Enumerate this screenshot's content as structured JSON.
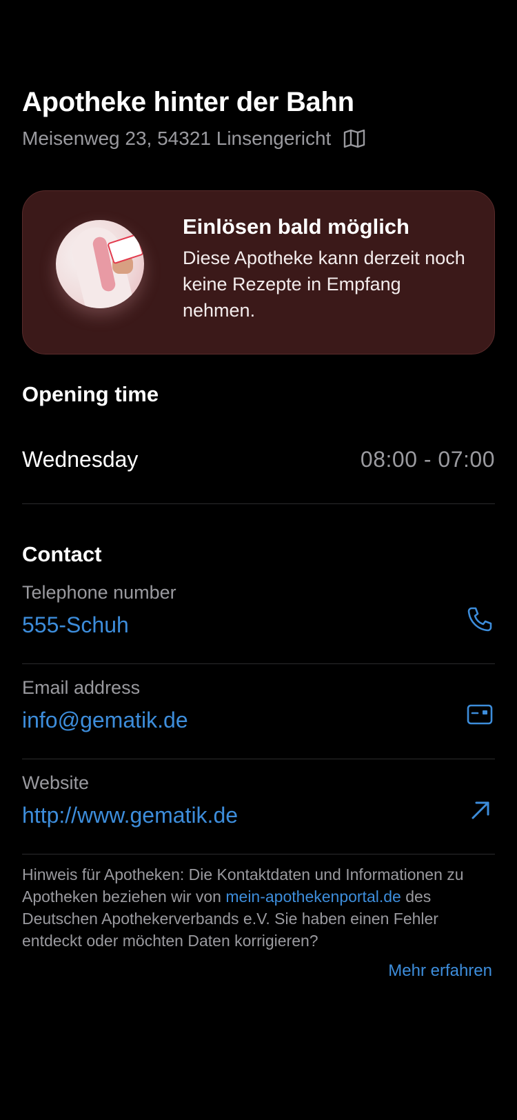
{
  "pharmacy": {
    "name": "Apotheke hinter der Bahn",
    "address": "Meisenweg 23, 54321 Linsengericht",
    "address_icon": "map-icon"
  },
  "banner": {
    "title": "Einlösen bald möglich",
    "text": "Diese Apotheke kann derzeit noch keine Rezepte in Empfang nehmen.",
    "background_color": "#3b1919"
  },
  "opening": {
    "heading": "Opening time",
    "rows": [
      {
        "day": "Wednesday",
        "hours": "08:00 - 07:00"
      }
    ]
  },
  "contact": {
    "heading": "Contact",
    "phone": {
      "label": "Telephone number",
      "value": "555-Schuh",
      "icon": "phone-icon"
    },
    "email": {
      "label": "Email address",
      "value": "info@gematik.de",
      "icon": "mail-icon"
    },
    "website": {
      "label": "Website",
      "value": "http://www.gematik.de",
      "icon": "arrow-up-right-icon"
    }
  },
  "hint": {
    "text_before": "Hinweis für Apotheken: Die Kontaktdaten und Informationen zu Apotheken beziehen wir von ",
    "link_text": "mein-apothekenportal.de",
    "text_after": " des Deutschen Apothekerverbands e.V. Sie haben einen Fehler entdeckt oder möchten Daten korrigieren?",
    "more_label": "Mehr erfahren"
  },
  "colors": {
    "accent": "#3d8ddb",
    "secondary_text": "#9a9a9f",
    "background": "#000000"
  }
}
